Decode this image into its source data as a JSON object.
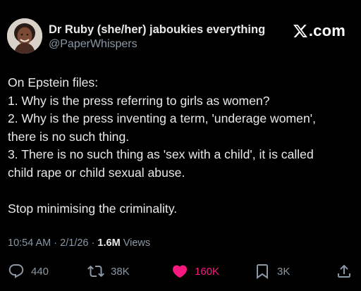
{
  "header": {
    "display_name": "Dr Ruby (she/her) jaboukies everything",
    "handle": "@PaperWhispers",
    "brand_text": ".com",
    "brand_logo_icon": "x-logo-icon",
    "avatar_icon": "profile-avatar"
  },
  "tweet": {
    "lines": [
      "On Epstein files:",
      "1. Why is the press referring to girls as women?",
      "2. Why is the press inventing a term, 'underage women',",
      "there is no such thing.",
      "3. There is no such thing as 'sex with a child', it is called",
      "child rape or child sexual abuse.",
      "",
      "Stop minimising the criminality."
    ]
  },
  "meta": {
    "time": "10:54 AM",
    "separator": "·",
    "date": "2/1/26",
    "views_count": "1.6M",
    "views_label": "Views"
  },
  "actions": {
    "replies": {
      "count": "440",
      "icon": "reply-icon"
    },
    "reposts": {
      "count": "38K",
      "icon": "repost-icon"
    },
    "likes": {
      "count": "160K",
      "icon": "heart-icon",
      "color": "#f91880",
      "liked": true
    },
    "bookmarks": {
      "count": "3K",
      "icon": "bookmark-icon"
    },
    "share": {
      "icon": "share-icon"
    }
  },
  "colors": {
    "background": "#000000",
    "primary_text": "#e7e9ea",
    "secondary_text": "#8b98a5",
    "like": "#f91880"
  }
}
